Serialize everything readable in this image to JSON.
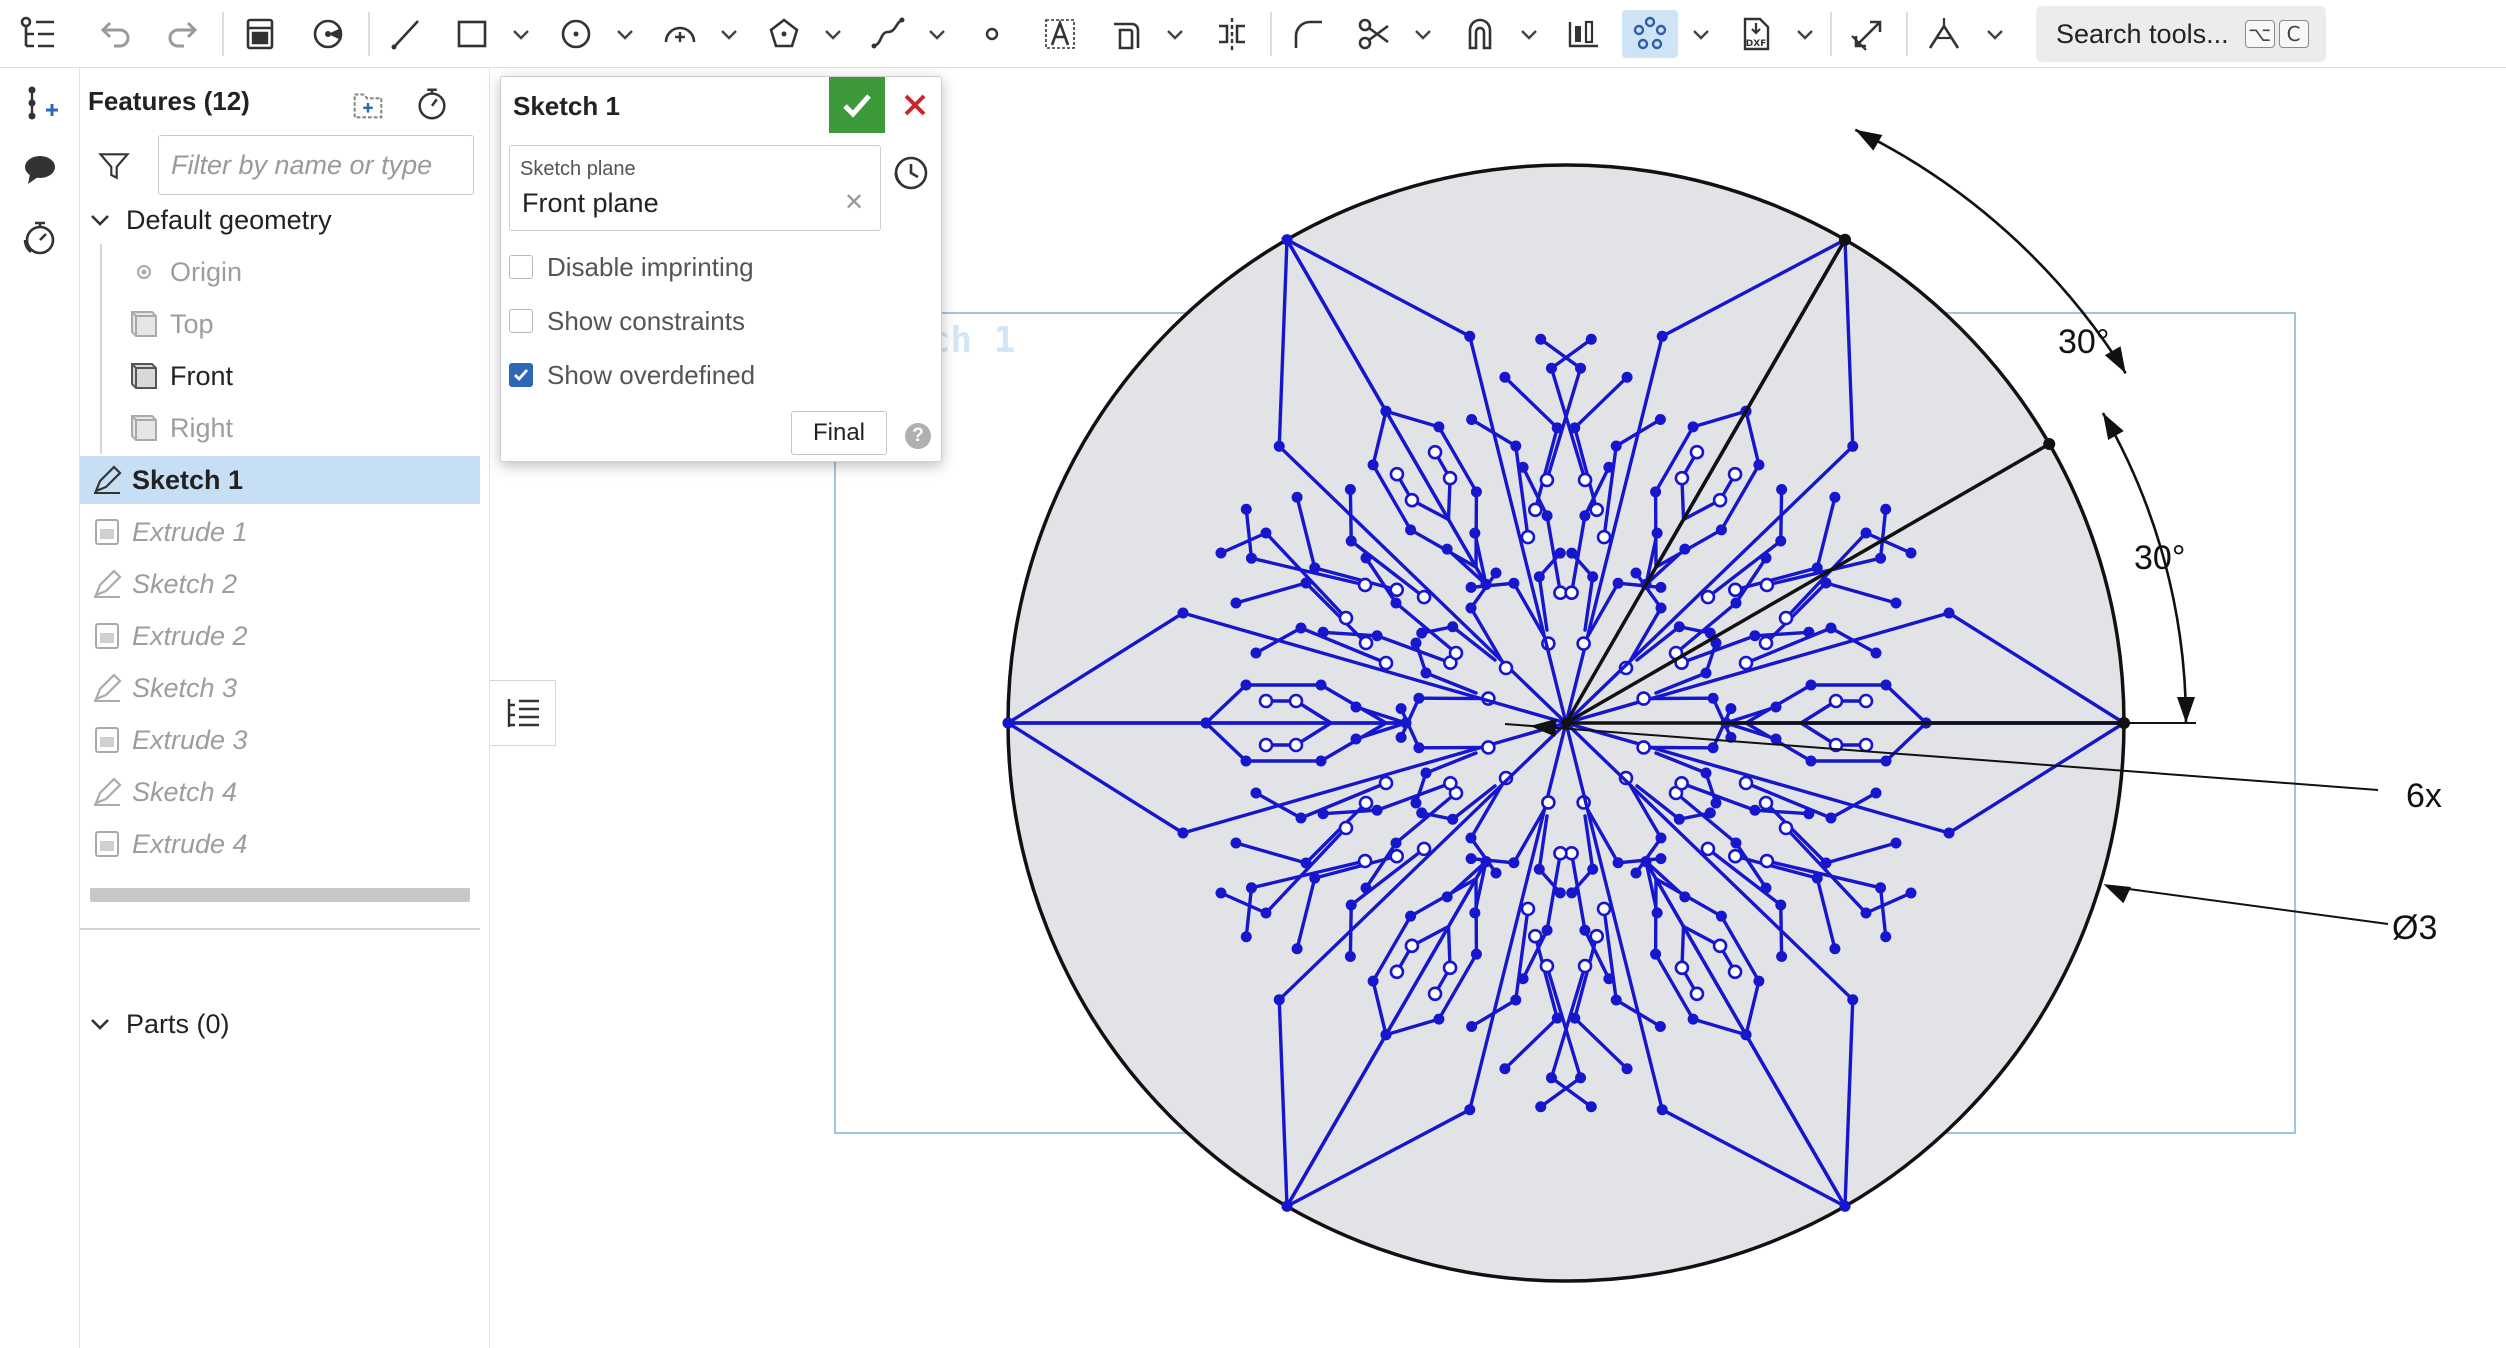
{
  "toolbar": {
    "search_label": "Search tools...",
    "search_keys": [
      "⌥",
      "C"
    ],
    "icons": [
      "feature-list-icon",
      "undo-icon",
      "redo-icon",
      "extrude-icon",
      "revolve-icon",
      "line-icon",
      "rectangle-icon",
      "circle-icon",
      "arc-icon",
      "polygon-icon",
      "spline-icon",
      "point-icon",
      "text-icon",
      "offset-icon",
      "mirror-icon",
      "fillet-icon",
      "trim-icon",
      "use-icon",
      "linear-pattern-icon",
      "circular-pattern-icon",
      "dxf-import-icon",
      "dimension-icon",
      "construction-icon"
    ]
  },
  "rail": {
    "icons": [
      "add-feature-icon",
      "comment-icon",
      "timer-icon"
    ]
  },
  "features_panel": {
    "title": "Features (12)",
    "filter_placeholder": "Filter by name or type",
    "default_geometry": "Default geometry",
    "geometry_items": [
      "Origin",
      "Top",
      "Front",
      "Right"
    ],
    "features": [
      "Sketch 1",
      "Extrude 1",
      "Sketch 2",
      "Extrude 2",
      "Sketch 3",
      "Extrude 3",
      "Sketch 4",
      "Extrude 4"
    ],
    "selected_feature": "Sketch 1",
    "parts": "Parts (0)"
  },
  "sketch_dialog": {
    "title": "Sketch 1",
    "plane_label": "Sketch plane",
    "plane_value": "Front plane",
    "options": [
      {
        "label": "Disable imprinting",
        "checked": false
      },
      {
        "label": "Show constraints",
        "checked": false
      },
      {
        "label": "Show overdefined",
        "checked": true
      }
    ],
    "final_button": "Final"
  },
  "canvas": {
    "sketch_watermark": "Sketch 1",
    "dimensions": {
      "angle_1": "30°",
      "angle_2": "30°",
      "pattern_count": "6x",
      "diameter": "Ø3"
    },
    "colors": {
      "sketch_blue": "#1616cc",
      "disc_fill": "#e2e3e6",
      "outline": "#111111",
      "selection_box": "#9cc6e8"
    }
  }
}
